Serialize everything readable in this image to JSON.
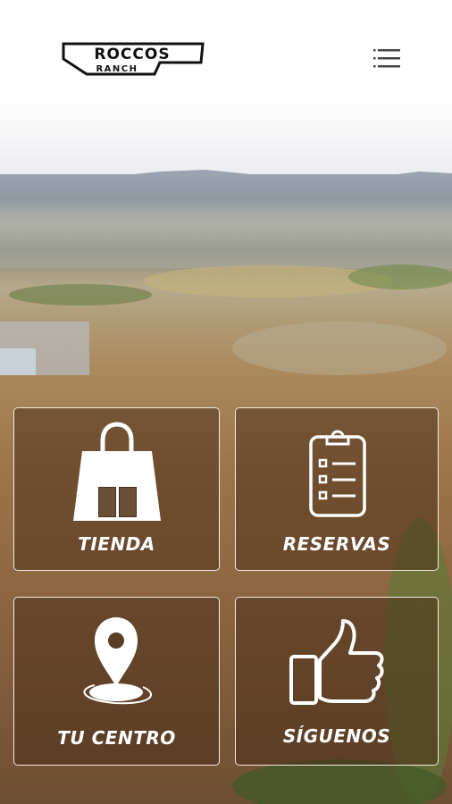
{
  "header": {
    "logo_text_top": "ROCCOS",
    "logo_text_bottom": "RANCH",
    "menu_icon": "hamburger-menu-icon"
  },
  "tiles": [
    {
      "label": "TIENDA",
      "icon": "shopping-bag-icon"
    },
    {
      "label": "RESERVAS",
      "icon": "clipboard-checklist-icon"
    },
    {
      "label": "TU CENTRO",
      "icon": "location-pin-icon"
    },
    {
      "label": "SÍGUENOS",
      "icon": "thumbs-up-icon"
    }
  ],
  "colors": {
    "tile_border": "#f2ece4",
    "tile_fill": "#462d19",
    "text": "#ffffff"
  }
}
